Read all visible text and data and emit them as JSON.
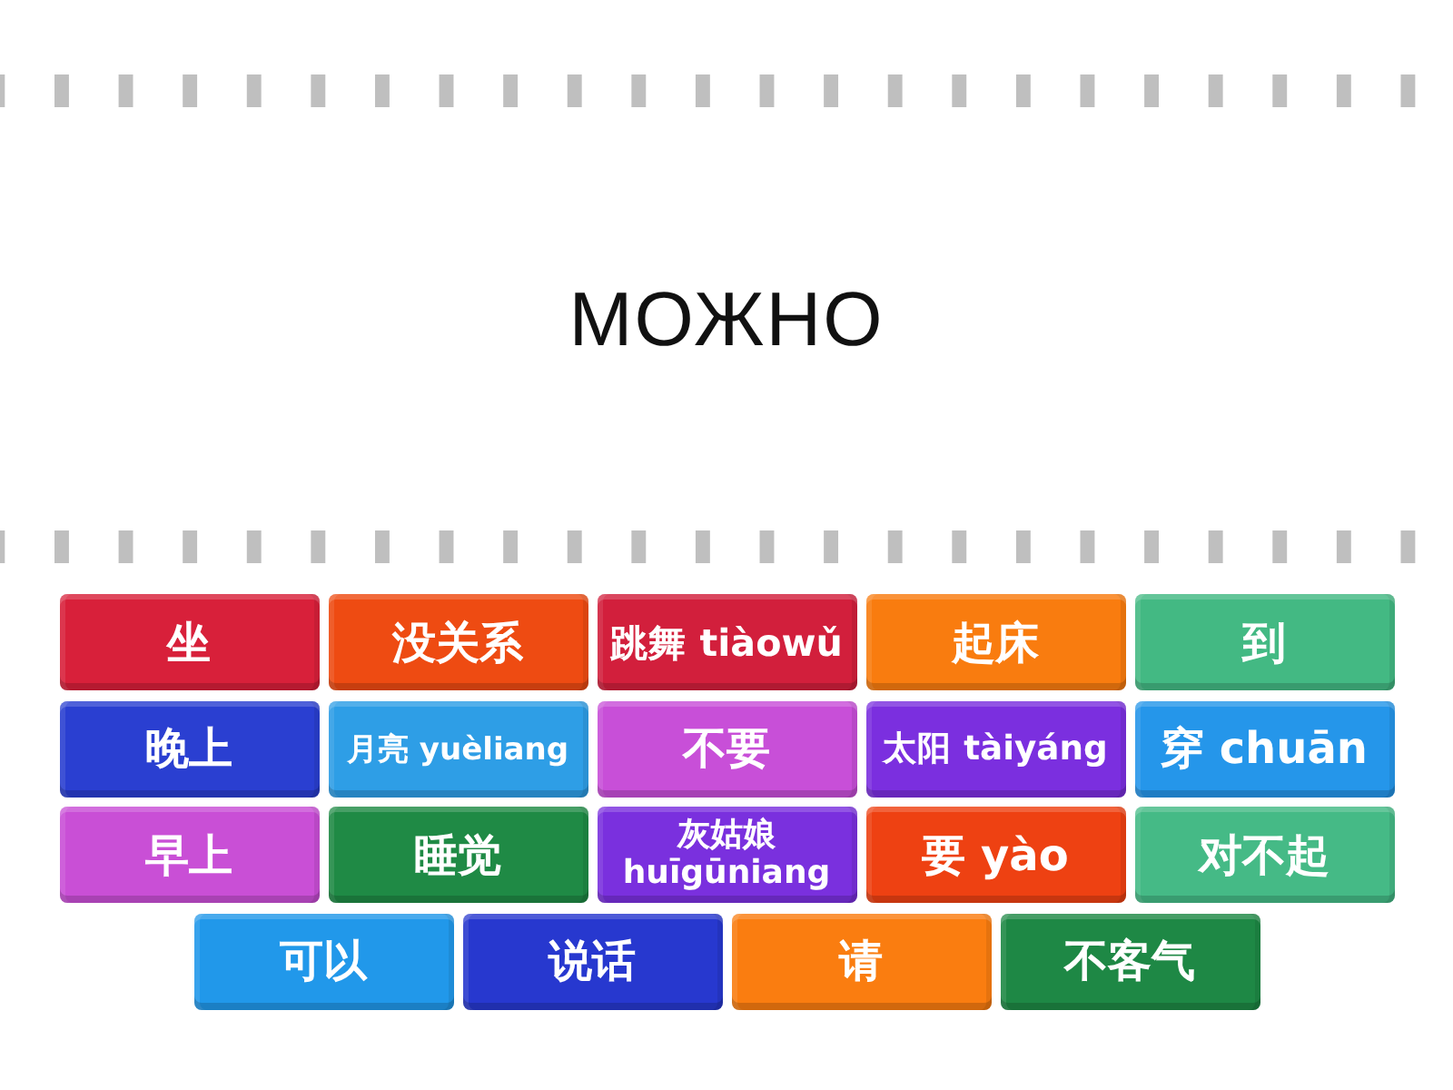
{
  "prompt": {
    "text": "МОЖНО"
  },
  "tiles": [
    {
      "label": "坐",
      "color": "#d8203a"
    },
    {
      "label": "没关系",
      "color": "#ee4b12"
    },
    {
      "label": "跳舞 tiàowǔ",
      "color": "#d21f3c"
    },
    {
      "label": "起床",
      "color": "#f97c0f"
    },
    {
      "label": "到",
      "color": "#43b983"
    },
    {
      "label": "晚上",
      "color": "#2a3fd1"
    },
    {
      "label": "月亮 yuèliang",
      "color": "#2e9ee6"
    },
    {
      "label": "不要",
      "color": "#c84fd8"
    },
    {
      "label": "太阳 tàiyáng",
      "color": "#7b2fdf"
    },
    {
      "label": "穿 chuān",
      "color": "#2596ea"
    },
    {
      "label": "早上",
      "color": "#c94fd6"
    },
    {
      "label": "睡觉",
      "color": "#1f8a45"
    },
    {
      "label": "灰姑娘 huīgūniang",
      "color": "#7a30de"
    },
    {
      "label": "要 yào",
      "color": "#ee4112"
    },
    {
      "label": "对不起",
      "color": "#45ba86"
    },
    {
      "label": "可以",
      "color": "#2198ea"
    },
    {
      "label": "说话",
      "color": "#2738cf"
    },
    {
      "label": "请",
      "color": "#fa7d10"
    },
    {
      "label": "不客气",
      "color": "#1e8845"
    }
  ]
}
